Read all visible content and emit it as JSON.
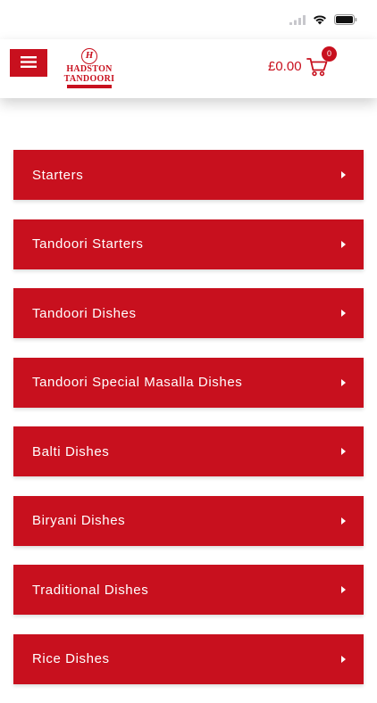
{
  "header": {
    "logo": {
      "emblem": "H",
      "line1": "HADSTON",
      "line2": "TANDOORI"
    },
    "cart": {
      "total": "£0.00",
      "count": "0"
    }
  },
  "categories": [
    {
      "label": "Starters"
    },
    {
      "label": "Tandoori Starters"
    },
    {
      "label": "Tandoori Dishes"
    },
    {
      "label": "Tandoori Special Masalla Dishes"
    },
    {
      "label": "Balti Dishes"
    },
    {
      "label": "Biryani Dishes"
    },
    {
      "label": "Traditional Dishes"
    },
    {
      "label": "Rice Dishes"
    }
  ],
  "colors": {
    "brand": "#c8101e",
    "background": "#ffffff",
    "text_on_brand": "#ffffff"
  }
}
